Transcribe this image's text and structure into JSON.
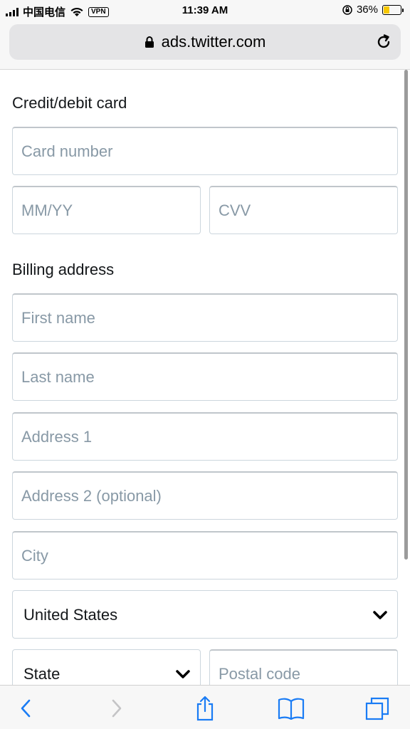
{
  "status_bar": {
    "carrier": "中国电信",
    "vpn": "VPN",
    "time": "11:39 AM",
    "battery": "36%",
    "battery_level": 0.36
  },
  "browser": {
    "url": "ads.twitter.com"
  },
  "form": {
    "card_section_title": "Credit/debit card",
    "card_number_placeholder": "Card number",
    "expiry_placeholder": "MM/YY",
    "cvv_placeholder": "CVV",
    "billing_section_title": "Billing address",
    "first_name_placeholder": "First name",
    "last_name_placeholder": "Last name",
    "address1_placeholder": "Address 1",
    "address2_placeholder": "Address 2 (optional)",
    "city_placeholder": "City",
    "country_value": "United States",
    "state_value": "State",
    "postal_code_placeholder": "Postal code"
  },
  "colors": {
    "accent": "#1a7cf5",
    "placeholder": "#8899a6"
  }
}
